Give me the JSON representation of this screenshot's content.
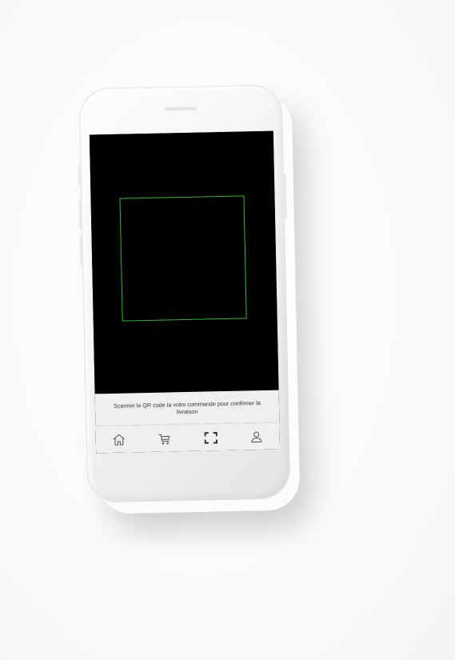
{
  "scanner": {
    "instruction": "Scanner le QR code la votre commande pour confirmer la livraison"
  },
  "tabbar": {
    "items": [
      {
        "icon": "home-icon"
      },
      {
        "icon": "cart-icon"
      },
      {
        "icon": "scan-icon",
        "active": true
      },
      {
        "icon": "user-icon"
      }
    ]
  },
  "colors": {
    "scan_frame": "#1fbf2a",
    "camera_bg": "#000000",
    "panel_bg": "#efefef",
    "icon": "#555555"
  }
}
